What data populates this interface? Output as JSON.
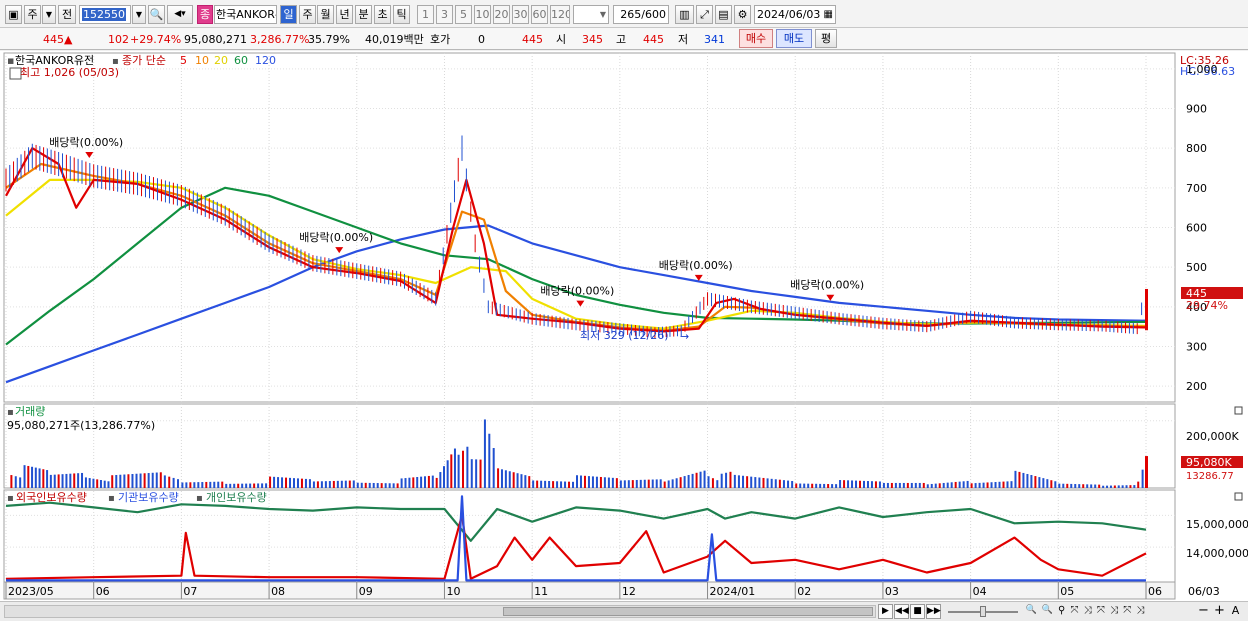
{
  "toolbar": {
    "period_unit": "주",
    "prev_label": "전",
    "code": "152550",
    "stock_name": "한국ANKOR유",
    "tag": "종",
    "periods": [
      "일",
      "주",
      "월",
      "년",
      "분",
      "초",
      "틱"
    ],
    "active_period": "일",
    "intervals": [
      "1",
      "3",
      "5",
      "10",
      "20",
      "30",
      "60",
      "120"
    ],
    "count": "265",
    "count_total": "/600",
    "date": "2024/06/03"
  },
  "quote": {
    "price": "445",
    "change": "102",
    "change_pct": "+29.74%",
    "volume": "95,080,271",
    "volume_pct": "3,286.77%",
    "turnover": "35.79%",
    "amount": "40,019백만",
    "hoga_label": "호가",
    "hoga_value": "0",
    "hoga_price": "445",
    "open_label": "시",
    "open": "345",
    "high_label": "고",
    "high": "445",
    "low_label": "저",
    "low": "341",
    "buy_label": "매수",
    "sell_label": "매도",
    "avg_label": "평"
  },
  "chart_data": {
    "type": "candlestick",
    "stock": "한국ANKOR유전",
    "ma_label": "종가 단순",
    "ma_periods": [
      "5",
      "10",
      "20",
      "60",
      "120"
    ],
    "ma_colors": [
      "#e00000",
      "#f08000",
      "#f0e000",
      "#109040",
      "#2a50e0"
    ],
    "high_note": "최고 1,026 (05/03)",
    "low_note": "최저 329 (12/26)",
    "lc_label": "LC:35.26",
    "hc_label": "HC:-56.63",
    "price_ticks": [
      "1,000",
      "900",
      "800",
      "700",
      "600",
      "500",
      "400",
      "300",
      "200"
    ],
    "price_tick_values": [
      1000,
      900,
      800,
      700,
      600,
      500,
      400,
      300,
      200
    ],
    "ylim": [
      160,
      1040
    ],
    "current_price_tag": "445",
    "current_pct_tag": "29.74%",
    "dividend_label": "배당락(0.00%)",
    "dividend_months": [
      0.95,
      3.8,
      6.55,
      7.9,
      9.4
    ],
    "months": [
      "2023/05",
      "06",
      "07",
      "08",
      "09",
      "10",
      "11",
      "12",
      "2024/01",
      "02",
      "03",
      "04",
      "05",
      "06"
    ],
    "month_index": [
      0,
      1,
      2,
      3,
      4,
      5,
      6,
      7,
      8,
      9,
      10,
      11,
      12,
      13
    ],
    "end_label": "06/03",
    "close": [
      [
        0,
        720
      ],
      [
        0.3,
        780
      ],
      [
        0.6,
        760
      ],
      [
        1,
        730
      ],
      [
        1.5,
        710
      ],
      [
        2,
        680
      ],
      [
        2.5,
        630
      ],
      [
        3,
        560
      ],
      [
        3.5,
        510
      ],
      [
        4,
        490
      ],
      [
        4.5,
        470
      ],
      [
        4.9,
        420
      ],
      [
        5.2,
        800
      ],
      [
        5.35,
        560
      ],
      [
        5.5,
        400
      ],
      [
        6,
        370
      ],
      [
        6.5,
        355
      ],
      [
        7,
        345
      ],
      [
        7.4,
        335
      ],
      [
        7.7,
        340
      ],
      [
        8,
        420
      ],
      [
        8.5,
        400
      ],
      [
        9,
        385
      ],
      [
        9.5,
        370
      ],
      [
        10,
        358
      ],
      [
        10.5,
        350
      ],
      [
        11,
        375
      ],
      [
        11.5,
        360
      ],
      [
        12,
        355
      ],
      [
        12.5,
        352
      ],
      [
        12.9,
        345
      ],
      [
        13,
        445
      ]
    ],
    "ma5": [
      [
        0,
        680
      ],
      [
        0.3,
        800
      ],
      [
        0.6,
        760
      ],
      [
        0.8,
        650
      ],
      [
        1,
        720
      ],
      [
        1.5,
        710
      ],
      [
        2,
        670
      ],
      [
        2.5,
        620
      ],
      [
        3,
        550
      ],
      [
        3.5,
        500
      ],
      [
        4,
        485
      ],
      [
        4.5,
        465
      ],
      [
        4.9,
        410
      ],
      [
        5.1,
        600
      ],
      [
        5.25,
        720
      ],
      [
        5.45,
        560
      ],
      [
        5.6,
        380
      ],
      [
        6,
        370
      ],
      [
        6.5,
        360
      ],
      [
        7,
        345
      ],
      [
        7.5,
        338
      ],
      [
        7.9,
        345
      ],
      [
        8.1,
        410
      ],
      [
        8.3,
        420
      ],
      [
        8.6,
        395
      ],
      [
        9,
        380
      ],
      [
        9.5,
        370
      ],
      [
        10,
        360
      ],
      [
        10.5,
        352
      ],
      [
        11,
        365
      ],
      [
        11.5,
        360
      ],
      [
        12,
        355
      ],
      [
        12.5,
        350
      ],
      [
        13,
        348
      ]
    ],
    "ma10": [
      [
        0,
        700
      ],
      [
        0.4,
        760
      ],
      [
        1,
        730
      ],
      [
        1.5,
        710
      ],
      [
        2,
        680
      ],
      [
        2.5,
        630
      ],
      [
        3,
        560
      ],
      [
        3.5,
        510
      ],
      [
        4,
        490
      ],
      [
        4.5,
        470
      ],
      [
        4.9,
        430
      ],
      [
        5.2,
        640
      ],
      [
        5.45,
        620
      ],
      [
        5.7,
        440
      ],
      [
        6,
        380
      ],
      [
        6.5,
        362
      ],
      [
        7,
        348
      ],
      [
        7.5,
        340
      ],
      [
        7.9,
        350
      ],
      [
        8.2,
        400
      ],
      [
        8.5,
        398
      ],
      [
        9,
        380
      ],
      [
        9.5,
        368
      ],
      [
        10,
        358
      ],
      [
        10.5,
        352
      ],
      [
        11,
        362
      ],
      [
        11.5,
        358
      ],
      [
        12,
        354
      ],
      [
        13,
        350
      ]
    ],
    "ma20": [
      [
        0,
        630
      ],
      [
        0.5,
        720
      ],
      [
        1,
        720
      ],
      [
        1.5,
        715
      ],
      [
        2,
        700
      ],
      [
        2.5,
        650
      ],
      [
        3,
        580
      ],
      [
        3.5,
        520
      ],
      [
        4,
        495
      ],
      [
        4.5,
        480
      ],
      [
        4.9,
        460
      ],
      [
        5.3,
        500
      ],
      [
        5.7,
        490
      ],
      [
        6,
        420
      ],
      [
        6.5,
        370
      ],
      [
        7,
        355
      ],
      [
        7.5,
        345
      ],
      [
        8,
        365
      ],
      [
        8.5,
        390
      ],
      [
        9,
        385
      ],
      [
        9.5,
        372
      ],
      [
        10,
        362
      ],
      [
        10.5,
        356
      ],
      [
        11,
        360
      ],
      [
        11.5,
        360
      ],
      [
        12,
        356
      ],
      [
        13,
        352
      ]
    ],
    "ma60": [
      [
        0,
        305
      ],
      [
        0.5,
        390
      ],
      [
        1,
        470
      ],
      [
        1.5,
        560
      ],
      [
        2,
        650
      ],
      [
        2.5,
        700
      ],
      [
        3,
        680
      ],
      [
        3.5,
        640
      ],
      [
        4,
        600
      ],
      [
        4.5,
        560
      ],
      [
        5,
        530
      ],
      [
        5.5,
        520
      ],
      [
        6,
        470
      ],
      [
        6.5,
        430
      ],
      [
        7,
        405
      ],
      [
        7.5,
        385
      ],
      [
        8,
        372
      ],
      [
        8.5,
        370
      ],
      [
        9,
        368
      ],
      [
        9.5,
        365
      ],
      [
        10,
        360
      ],
      [
        10.5,
        358
      ],
      [
        11,
        358
      ],
      [
        12,
        360
      ],
      [
        13,
        362
      ]
    ],
    "ma120": [
      [
        0,
        210
      ],
      [
        0.5,
        250
      ],
      [
        1,
        290
      ],
      [
        1.5,
        330
      ],
      [
        2,
        370
      ],
      [
        2.5,
        410
      ],
      [
        3,
        450
      ],
      [
        3.5,
        500
      ],
      [
        4,
        540
      ],
      [
        4.5,
        570
      ],
      [
        5,
        595
      ],
      [
        5.5,
        605
      ],
      [
        6,
        560
      ],
      [
        6.5,
        530
      ],
      [
        7,
        500
      ],
      [
        7.5,
        480
      ],
      [
        8,
        460
      ],
      [
        8.5,
        440
      ],
      [
        9,
        425
      ],
      [
        9.5,
        410
      ],
      [
        10,
        400
      ],
      [
        10.5,
        390
      ],
      [
        11,
        380
      ],
      [
        11.5,
        372
      ],
      [
        12,
        368
      ],
      [
        13,
        365
      ]
    ],
    "volume_panel": {
      "label": "거래량",
      "value_text": "95,080,271주(13,286.77%)",
      "tick": "200,000K",
      "tick_value": 200000,
      "tag": "95,080K",
      "tag2": "13286.77",
      "ylim": [
        0,
        250000
      ],
      "values_k": [
        [
          0.05,
          110000
        ],
        [
          0.2,
          80000
        ],
        [
          0.5,
          60000
        ],
        [
          0.9,
          70000
        ],
        [
          1.2,
          40000
        ],
        [
          1.8,
          50000
        ],
        [
          2,
          30000
        ],
        [
          2.5,
          35000
        ],
        [
          3,
          40000
        ],
        [
          3.5,
          30000
        ],
        [
          4,
          35000
        ],
        [
          4.5,
          30000
        ],
        [
          4.9,
          40000
        ],
        [
          5.15,
          180000
        ],
        [
          5.3,
          245000
        ],
        [
          5.45,
          240000
        ],
        [
          5.6,
          90000
        ],
        [
          6,
          50000
        ],
        [
          6.5,
          40000
        ],
        [
          7,
          30000
        ],
        [
          7.5,
          35000
        ],
        [
          8,
          100000
        ],
        [
          8.15,
          50000
        ],
        [
          8.3,
          60000
        ],
        [
          9,
          30000
        ],
        [
          9.5,
          25000
        ],
        [
          10,
          20000
        ],
        [
          10.5,
          20000
        ],
        [
          11,
          40000
        ],
        [
          11.5,
          60000
        ],
        [
          12,
          20000
        ],
        [
          12.5,
          15000
        ],
        [
          12.9,
          20000
        ],
        [
          13,
          95080
        ]
      ]
    },
    "holding_panel": {
      "series": [
        "외국인보유수량",
        "기관보유수량",
        "개인보유수량"
      ],
      "colors": [
        "#e00000",
        "#2a50e0",
        "#208050"
      ],
      "ticks": [
        "15,000,000",
        "14,000,000"
      ],
      "tick_values": [
        15000000,
        14000000
      ],
      "ylim": [
        12900000,
        15800000
      ],
      "green": [
        [
          0,
          15300000
        ],
        [
          0.5,
          15400000
        ],
        [
          1,
          15250000
        ],
        [
          1.5,
          15100000
        ],
        [
          2,
          15350000
        ],
        [
          2.5,
          15300000
        ],
        [
          3,
          15200000
        ],
        [
          3.5,
          15150000
        ],
        [
          4,
          15250000
        ],
        [
          4.5,
          15200000
        ],
        [
          5,
          15200000
        ],
        [
          5.3,
          14200000
        ],
        [
          5.6,
          15200000
        ],
        [
          6,
          14800000
        ],
        [
          6.5,
          15250000
        ],
        [
          7,
          15150000
        ],
        [
          7.5,
          14900000
        ],
        [
          8,
          15200000
        ],
        [
          8.2,
          14900000
        ],
        [
          8.5,
          15100000
        ],
        [
          9,
          14900000
        ],
        [
          9.5,
          15250000
        ],
        [
          10,
          14950000
        ],
        [
          10.5,
          15100000
        ],
        [
          11,
          15200000
        ],
        [
          11.5,
          14750000
        ],
        [
          12,
          14800000
        ],
        [
          12.5,
          14750000
        ],
        [
          13,
          14550000
        ]
      ],
      "red": [
        [
          0,
          13000000
        ],
        [
          1,
          13050000
        ],
        [
          2,
          13100000
        ],
        [
          2.05,
          14450000
        ],
        [
          2.15,
          13100000
        ],
        [
          3,
          13050000
        ],
        [
          4,
          13050000
        ],
        [
          5,
          13000000
        ],
        [
          5.2,
          15000000
        ],
        [
          5.3,
          13000000
        ],
        [
          5.6,
          13400000
        ],
        [
          5.8,
          14300000
        ],
        [
          6,
          13600000
        ],
        [
          6.2,
          14300000
        ],
        [
          6.5,
          13400000
        ],
        [
          7,
          13500000
        ],
        [
          7.3,
          14500000
        ],
        [
          7.5,
          13200000
        ],
        [
          8,
          13700000
        ],
        [
          8.2,
          14200000
        ],
        [
          8.5,
          13500000
        ],
        [
          9,
          13600000
        ],
        [
          9.5,
          13300000
        ],
        [
          10,
          13600000
        ],
        [
          10.5,
          13200000
        ],
        [
          11,
          13500000
        ],
        [
          11.5,
          14300000
        ],
        [
          11.8,
          13600000
        ],
        [
          12,
          13300000
        ],
        [
          12.5,
          13100000
        ],
        [
          13,
          13800000
        ]
      ],
      "blue": [
        [
          0,
          12950000
        ],
        [
          5.15,
          12950000
        ],
        [
          5.2,
          15600000
        ],
        [
          5.25,
          12950000
        ],
        [
          8,
          12950000
        ],
        [
          8.05,
          14400000
        ],
        [
          8.1,
          12950000
        ],
        [
          13,
          12950000
        ]
      ]
    }
  }
}
